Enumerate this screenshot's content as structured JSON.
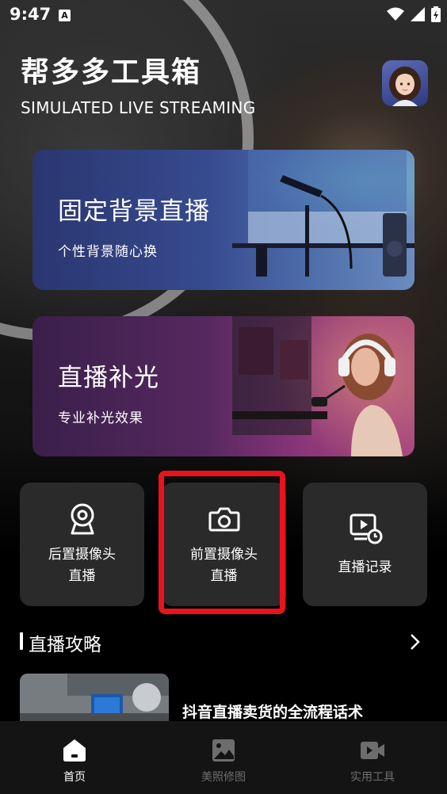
{
  "status_bar": {
    "time": "9:47",
    "notification_letter": "A"
  },
  "header": {
    "title": "帮多多工具箱",
    "subtitle": "SIMULATED LIVE STREAMING"
  },
  "cards": [
    {
      "title": "固定背景直播",
      "description": "个性背景随心换"
    },
    {
      "title": "直播补光",
      "description": "专业补光效果"
    }
  ],
  "tiles": [
    {
      "line1": "后置摄像头",
      "line2": "直播",
      "icon": "webcam-icon"
    },
    {
      "line1": "前置摄像头",
      "line2": "直播",
      "icon": "camera-icon"
    },
    {
      "label": "直播记录",
      "icon": "video-history-icon"
    }
  ],
  "section": {
    "title": "直播攻略"
  },
  "article": {
    "title": "抖音直播卖货的全流程话术"
  },
  "nav": [
    {
      "label": "首页",
      "icon": "home-icon",
      "active": true
    },
    {
      "label": "美照修图",
      "icon": "image-icon",
      "active": false
    },
    {
      "label": "实用工具",
      "icon": "video-icon",
      "active": false
    }
  ],
  "colors": {
    "highlight": "#e8131d",
    "tile_bg": "#2a2a2a",
    "nav_bg": "#141414",
    "nav_inactive": "#6d6d6d"
  }
}
